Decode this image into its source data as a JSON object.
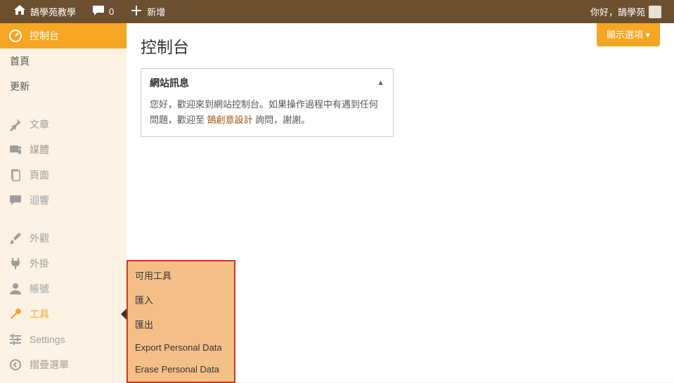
{
  "topbar": {
    "site_name": "鵠學苑教學",
    "comments_count": "0",
    "add_new": "新增",
    "greeting": "你好，鵠學苑"
  },
  "sidebar": {
    "dashboard": "控制台",
    "home": "首頁",
    "updates": "更新",
    "posts": "文章",
    "media": "媒體",
    "pages": "頁面",
    "comments": "迴響",
    "appearance": "外觀",
    "plugins": "外掛",
    "users": "帳號",
    "tools": "工具",
    "settings": "Settings",
    "collapse": "摺疊選單"
  },
  "page": {
    "title": "控制台",
    "screen_options": "顯示選項"
  },
  "panel": {
    "title": "網站訊息",
    "body_prefix": "您好，歡迎來到網站控制台。如果操作過程中有遇到任何問題，歡迎至 ",
    "link_text": "鵠創意設計",
    "body_suffix": " 詢問，謝謝。"
  },
  "flyout": {
    "items": [
      "可用工具",
      "匯入",
      "匯出",
      "Export Personal Data",
      "Erase Personal Data"
    ]
  }
}
